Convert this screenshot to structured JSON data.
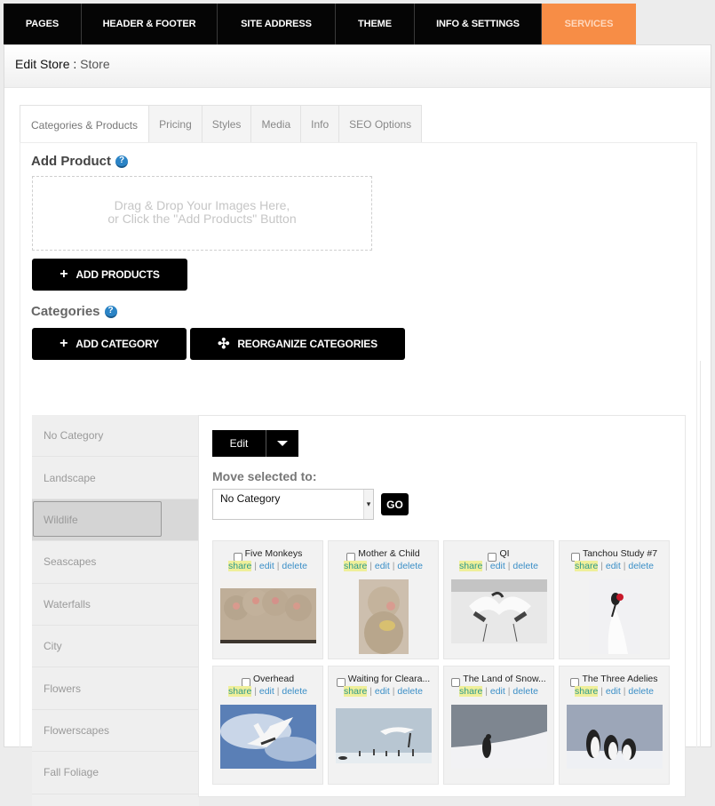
{
  "topnav": {
    "items": [
      {
        "label": "PAGES"
      },
      {
        "label": "HEADER & FOOTER"
      },
      {
        "label": "SITE ADDRESS"
      },
      {
        "label": "THEME"
      },
      {
        "label": "INFO & SETTINGS"
      },
      {
        "label": "SERVICES",
        "active": true
      }
    ],
    "accent_color": "#f78d46"
  },
  "header": {
    "title": "Edit Store",
    "separator": " : ",
    "subtitle": "Store"
  },
  "tabs": [
    {
      "label": "Categories & Products",
      "active": true
    },
    {
      "label": "Pricing"
    },
    {
      "label": "Styles"
    },
    {
      "label": "Media"
    },
    {
      "label": "Info"
    },
    {
      "label": "SEO Options"
    }
  ],
  "add_product": {
    "title": "Add Product",
    "help_icon": "question-circle-icon",
    "dropzone_line1": "Drag & Drop Your Images Here,",
    "dropzone_line2": "or Click the \"Add Products\" Button",
    "button_label": "ADD PRODUCTS",
    "button_icon": "+"
  },
  "categories": {
    "title": "Categories",
    "help_icon": "question-circle-icon",
    "add_button": "ADD CATEGORY",
    "add_icon": "+",
    "reorganize_button": "REORGANIZE CATEGORIES",
    "reorganize_icon": "✣",
    "items": [
      {
        "label": "No Category"
      },
      {
        "label": "Landscape"
      },
      {
        "label": "Wildlife",
        "selected": true
      },
      {
        "label": "Seascapes"
      },
      {
        "label": "Waterfalls"
      },
      {
        "label": "City"
      },
      {
        "label": "Flowers"
      },
      {
        "label": "Flowerscapes"
      },
      {
        "label": "Fall Foliage"
      }
    ]
  },
  "products_panel": {
    "edit_button": "Edit",
    "move_label": "Move selected to:",
    "move_select_value": "No Category",
    "go_button": "GO",
    "action_labels": {
      "share": "share",
      "edit": "edit",
      "delete": "delete",
      "separator": " | "
    },
    "products": [
      {
        "title": "Five Monkeys",
        "image": "snow-monkeys-group"
      },
      {
        "title": "Mother & Child",
        "image": "snow-monkey-mother"
      },
      {
        "title": "QI",
        "image": "cranes-dancing"
      },
      {
        "title": "Tanchou Study #7",
        "image": "crane-portrait"
      },
      {
        "title": "Overhead",
        "image": "crane-flying-sky"
      },
      {
        "title": "Waiting for Cleara...",
        "image": "crane-landing-flock"
      },
      {
        "title": "The Land of Snow...",
        "image": "penguin-snow"
      },
      {
        "title": "The Three Adelies",
        "image": "three-penguins"
      }
    ]
  }
}
